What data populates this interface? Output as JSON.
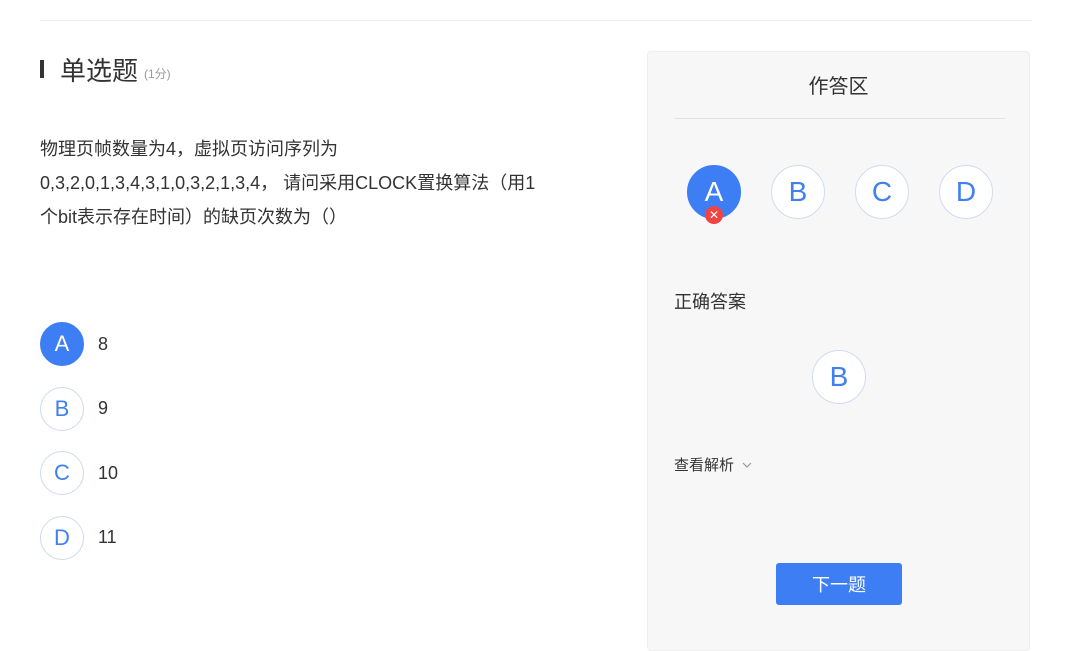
{
  "question": {
    "type": "单选题",
    "score": "(1分)",
    "text_lines": [
      "物理页帧数量为4，虚拟页访问序列为",
      "0,3,2,0,1,3,4,3,1,0,3,2,1,3,4， 请问采用CLOCK置换算法（用1",
      "个bit表示存在时间）的缺页次数为（）"
    ],
    "options": [
      {
        "letter": "A",
        "text": "8",
        "selected": true
      },
      {
        "letter": "B",
        "text": "9",
        "selected": false
      },
      {
        "letter": "C",
        "text": "10",
        "selected": false
      },
      {
        "letter": "D",
        "text": "11",
        "selected": false
      }
    ]
  },
  "answer_panel": {
    "title": "作答区",
    "choices": [
      "A",
      "B",
      "C",
      "D"
    ],
    "selected": "A",
    "wrong_mark": "✕",
    "correct_label": "正确答案",
    "correct_answer": "B",
    "analysis_label": "查看解析",
    "analysis_icon": "chevron-down-icon",
    "next_button": "下一题"
  },
  "colors": {
    "accent": "#3d7ef5",
    "wrong": "#ef4444",
    "panel_bg": "#f7f7f7"
  }
}
